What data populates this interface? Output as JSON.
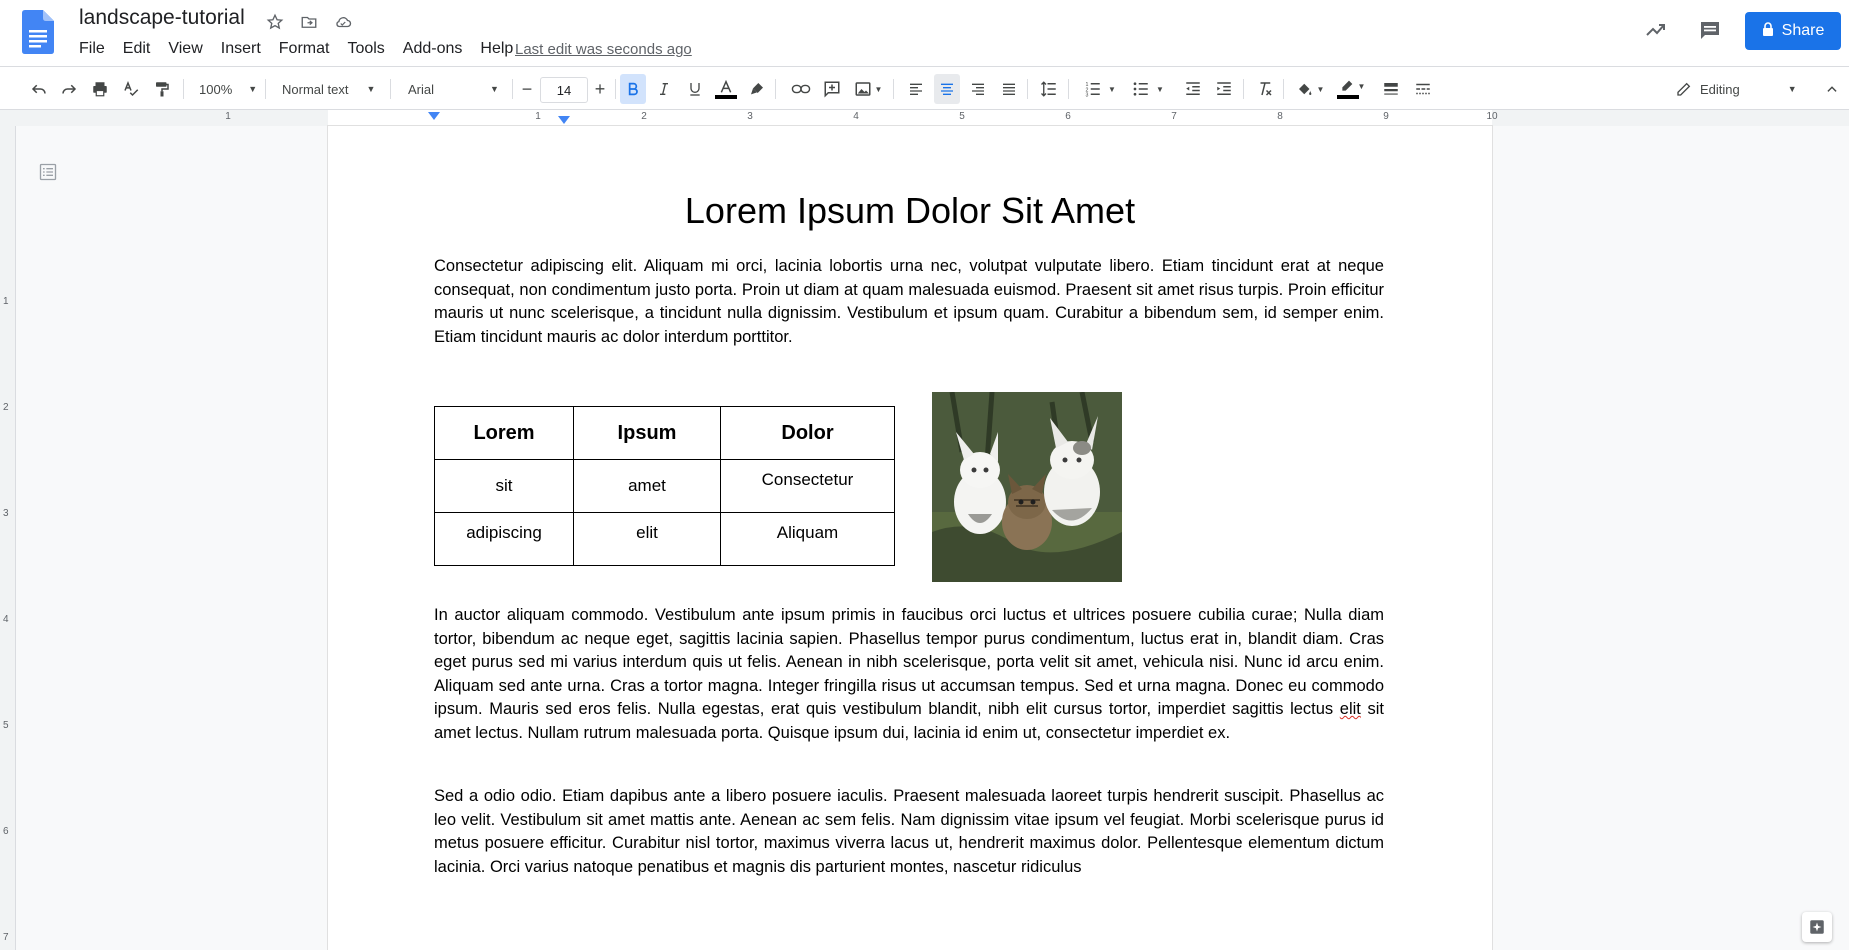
{
  "header": {
    "title": "landscape-tutorial",
    "menus": [
      "File",
      "Edit",
      "View",
      "Insert",
      "Format",
      "Tools",
      "Add-ons",
      "Help"
    ],
    "last_edit": "Last edit was seconds ago",
    "share_label": "Share"
  },
  "toolbar": {
    "zoom": "100%",
    "style": "Normal text",
    "font": "Arial",
    "font_size": "14",
    "mode": "Editing"
  },
  "ruler": {
    "labels": [
      "1",
      "1",
      "2",
      "3",
      "4",
      "5",
      "6",
      "7",
      "8",
      "9",
      "10"
    ],
    "vertical_labels": [
      "1",
      "2",
      "3",
      "4",
      "5",
      "6",
      "7"
    ]
  },
  "document": {
    "heading": "Lorem Ipsum Dolor Sit Amet",
    "para1": "Consectetur adipiscing elit. Aliquam mi orci, lacinia lobortis urna nec, volutpat vulputate libero. Etiam tincidunt erat at neque consequat, non condimentum justo porta. Proin ut diam at quam malesuada euismod. Praesent sit amet risus turpis. Proin efficitur mauris ut nunc scelerisque, a tincidunt nulla dignissim. Vestibulum et ipsum quam. Curabitur a bibendum sem, id semper enim. Etiam tincidunt mauris ac dolor interdum porttitor.",
    "table": {
      "headers": [
        "Lorem",
        "Ipsum",
        "Dolor"
      ],
      "rows": [
        [
          "sit",
          "amet",
          "Consectetur"
        ],
        [
          "adipiscing",
          "elit",
          "Aliquam"
        ]
      ]
    },
    "para2_a": "In auctor aliquam commodo. Vestibulum ante ipsum primis in faucibus orci luctus et ultrices posuere cubilia curae; Nulla diam tortor, bibendum ac neque eget, sagittis lacinia sapien. Phasellus tempor purus condimentum, luctus erat in, blandit diam. Cras eget purus sed mi varius interdum quis ut felis. Aenean in nibh scelerisque, porta velit sit amet, vehicula nisi. Nunc id arcu enim. Aliquam sed ante urna. Cras a tortor magna. Integer fringilla risus ut accumsan tempus. Sed et urna magna. Donec eu commodo ipsum. Mauris sed eros felis. Nulla egestas, erat quis vestibulum blandit, nibh elit cursus tortor, imperdiet sagittis lectus ",
    "para2_misspelled": "elit",
    "para2_b": " sit amet lectus. Nullam rutrum malesuada porta. Quisque ipsum dui, lacinia id enim ut, consectetur imperdiet ex.",
    "para3": "Sed a odio odio. Etiam dapibus ante a libero posuere iaculis. Praesent malesuada laoreet turpis hendrerit suscipit. Phasellus ac leo velit. Vestibulum sit amet mattis ante. Aenean ac sem felis. Nam dignissim vitae ipsum vel feugiat. Morbi scelerisque purus id metus posuere efficitur. Curabitur nisl tortor, maximus viverra lacus ut, hendrerit maximus dolor. Pellentesque elementum dictum lacinia. Orci varius natoque penatibus et magnis dis parturient montes, nascetur ridiculus"
  },
  "colors": {
    "accent": "#1a73e8",
    "docs_blue": "#4285f4"
  },
  "icons": [
    "docs-logo-icon",
    "star-icon",
    "move-to-folder-icon",
    "cloud-saved-icon",
    "activity-trend-icon",
    "comments-icon",
    "lock-icon",
    "undo-icon",
    "redo-icon",
    "print-icon",
    "spellcheck-icon",
    "paint-format-icon",
    "bold-icon",
    "italic-icon",
    "underline-icon",
    "text-color-icon",
    "highlight-icon",
    "link-icon",
    "add-comment-icon",
    "insert-image-icon",
    "align-left-icon",
    "align-center-icon",
    "align-right-icon",
    "justify-icon",
    "line-spacing-icon",
    "numbered-list-icon",
    "bulleted-list-icon",
    "decrease-indent-icon",
    "increase-indent-icon",
    "clear-formatting-icon",
    "cell-fill-icon",
    "border-color-icon",
    "border-width-icon",
    "border-dash-icon",
    "pencil-icon",
    "document-outline-icon",
    "explore-icon"
  ]
}
